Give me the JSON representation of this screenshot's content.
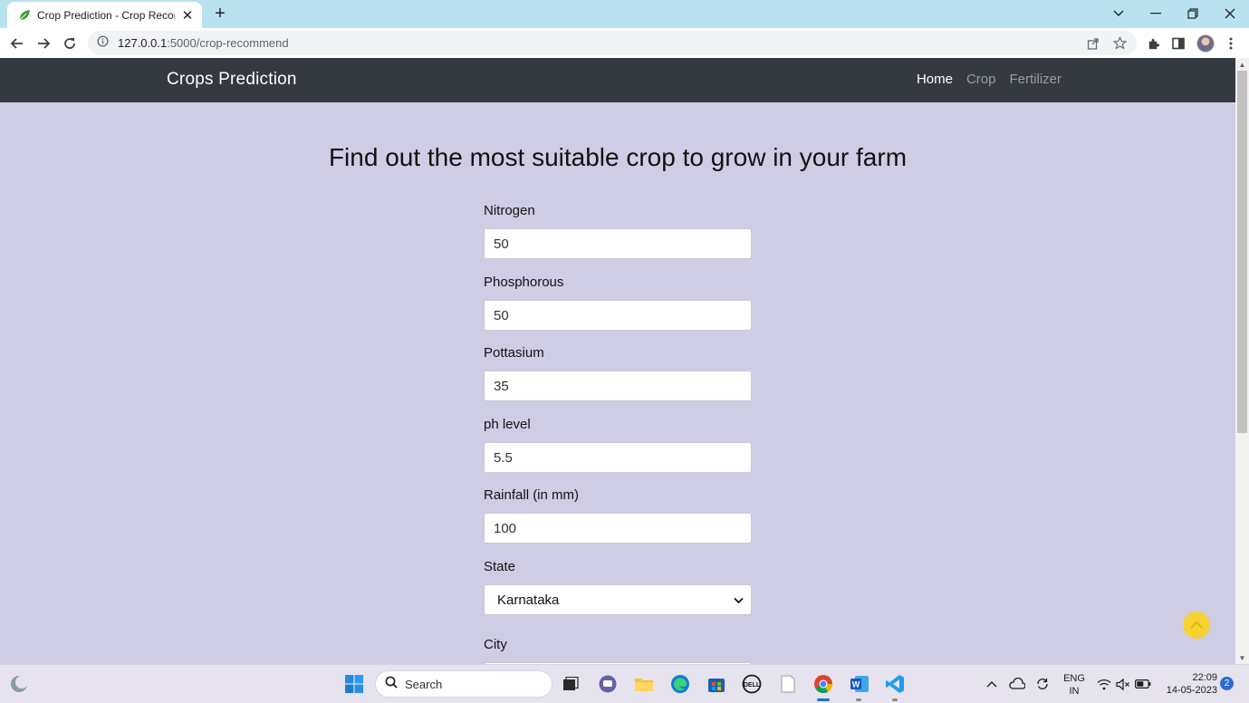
{
  "browser": {
    "tab_title": "Crop Prediction - Crop Recommend",
    "url_host": "127.0.0.1",
    "url_rest": ":5000/crop-recommend"
  },
  "navbar": {
    "brand": "Crops Prediction",
    "links": [
      {
        "label": "Home",
        "active": true
      },
      {
        "label": "Crop",
        "active": false
      },
      {
        "label": "Fertilizer",
        "active": false
      }
    ]
  },
  "main": {
    "heading": "Find out the most suitable crop to grow in your farm"
  },
  "form": {
    "nitrogen": {
      "label": "Nitrogen",
      "value": "50"
    },
    "phosphorous": {
      "label": "Phosphorous",
      "value": "50"
    },
    "pottasium": {
      "label": "Pottasium",
      "value": "35"
    },
    "ph": {
      "label": "ph level",
      "value": "5.5"
    },
    "rainfall": {
      "label": "Rainfall (in mm)",
      "value": "100"
    },
    "state": {
      "label": "State",
      "value": "Karnataka"
    },
    "city": {
      "label": "City"
    }
  },
  "colors": {
    "page_bg": "#cfcde4",
    "navbar_bg": "#343a40",
    "scroll_top_button": "#f7d231"
  },
  "taskbar": {
    "search_label": "Search",
    "lang_line1": "ENG",
    "lang_line2": "IN",
    "time": "22:09",
    "date": "14-05-2023",
    "notification_count": "2"
  }
}
